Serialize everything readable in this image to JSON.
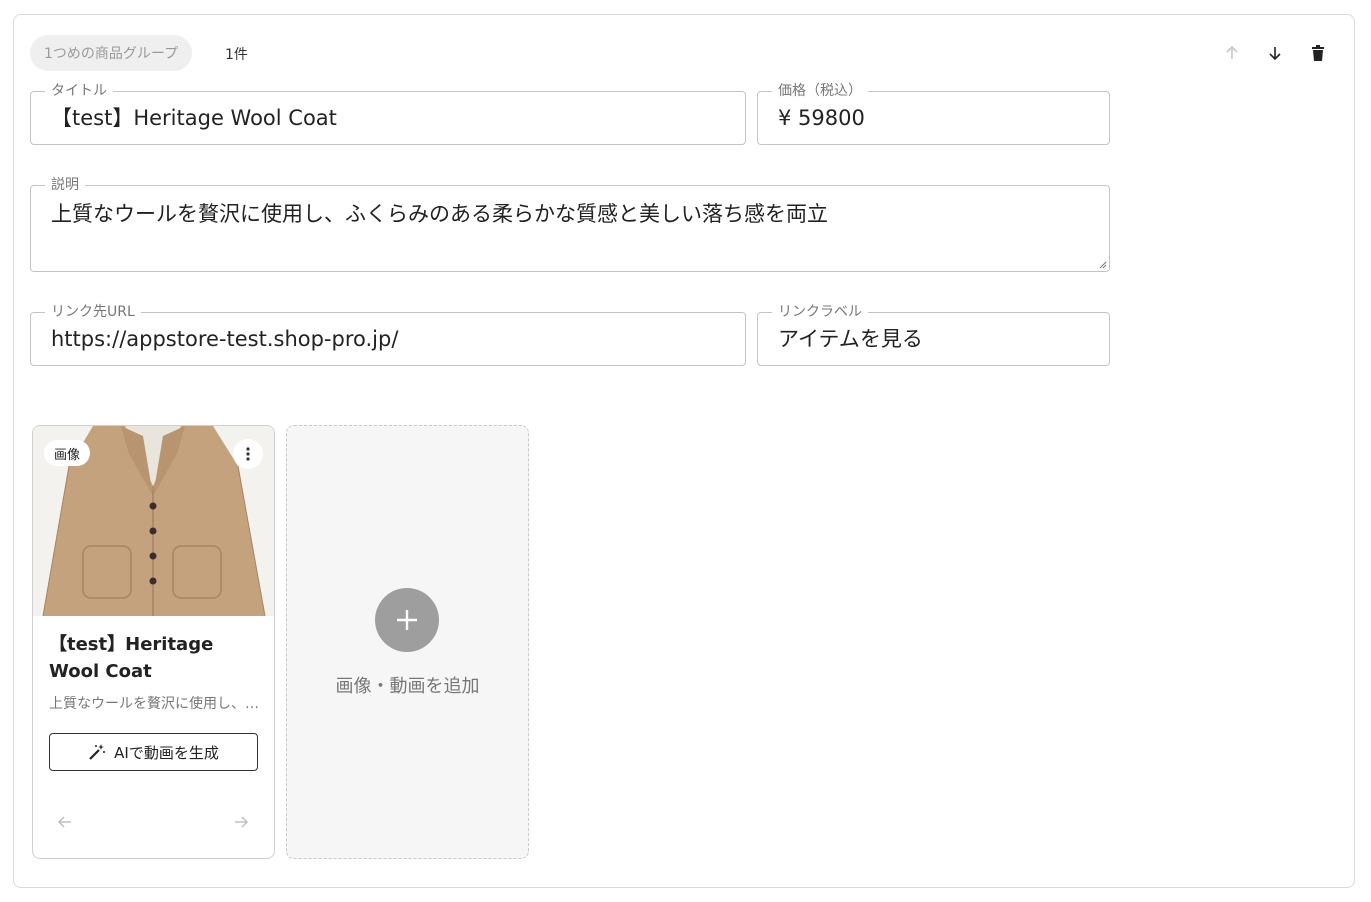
{
  "group": {
    "chip_label": "1つめの商品グループ",
    "count_label": "1件"
  },
  "toolbar": {
    "move_up_icon": "arrow-up-icon",
    "move_down_icon": "arrow-down-icon",
    "delete_icon": "trash-icon"
  },
  "form": {
    "title": {
      "label": "タイトル",
      "value": "【test】Heritage Wool Coat"
    },
    "price": {
      "label": "価格（税込）",
      "value": "¥ 59800"
    },
    "description": {
      "label": "説明",
      "value": "上質なウールを贅沢に使用し、ふくらみのある柔らかな質感と美しい落ち感を両立"
    },
    "link_url": {
      "label": "リンク先URL",
      "value": "https://appstore-test.shop-pro.jp/"
    },
    "link_label": {
      "label": "リンクラベル",
      "value": "アイテムを見る"
    }
  },
  "card": {
    "badge": "画像",
    "title": "【test】Heritage Wool Coat",
    "description": "上質なウールを贅沢に使用し、ふくらみのある柔らかな質感と美しい落ち感を両立",
    "ai_button": "AIで動画を生成"
  },
  "add_tile": {
    "label": "画像・動画を追加"
  },
  "colors": {
    "coat": "#c4a27e",
    "disabled": "#bdbdbd",
    "plus_circle": "#9e9e9e"
  }
}
